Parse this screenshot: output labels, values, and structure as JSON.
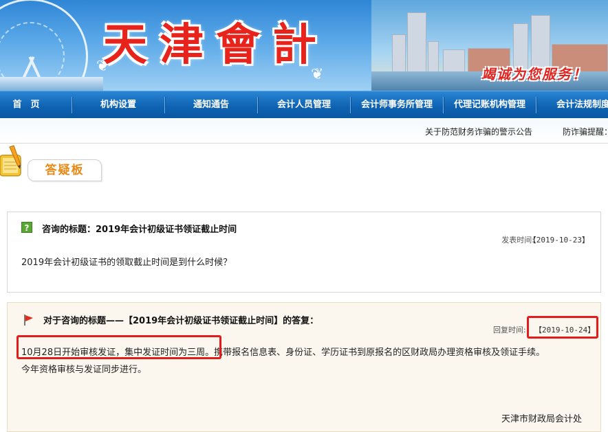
{
  "banner": {
    "title": "天津會計",
    "slogan": "竭诚为您服务！"
  },
  "nav": {
    "items": [
      {
        "label": "首　页"
      },
      {
        "label": "机构设置"
      },
      {
        "label": "通知通告"
      },
      {
        "label": "会计人员管理"
      },
      {
        "label": "会计师事务所管理"
      },
      {
        "label": "代理记账机构管理"
      },
      {
        "label": "会计法规制度"
      }
    ]
  },
  "notice": {
    "items": [
      {
        "text": "关于防范财务诈骗的警示公告"
      },
      {
        "text": "防诈骗提醒："
      }
    ]
  },
  "board": {
    "title": "答疑板"
  },
  "question": {
    "icon_glyph": "?",
    "title": "咨询的标题：2019年会计初级证书领证截止时间",
    "date_label": "发表时间:",
    "date": "【2019-10-23】",
    "body": "2019年会计初级证书的领取截止时间是到什么时候？"
  },
  "answer": {
    "title": "对于咨询的标题——【2019年会计初级证书领证截止时间】的答复：",
    "date_label": "回复时间:",
    "date": "【2019-10-24】",
    "line1": "10月28日开始审核发证，集中发证时间为三周。携带报名信息表、身份证、学历证书到原报名的区财政局办理资格审核及领证手续。",
    "line2": "今年资格审核与发证同步进行。",
    "signature": "天津市财政局会计处"
  },
  "colors": {
    "nav_blue": "#0f63b3",
    "title_red": "#e8231c",
    "board_orange": "#e88a17",
    "highlight_red": "#e21b1b",
    "answer_bg": "#fbf7ee"
  }
}
